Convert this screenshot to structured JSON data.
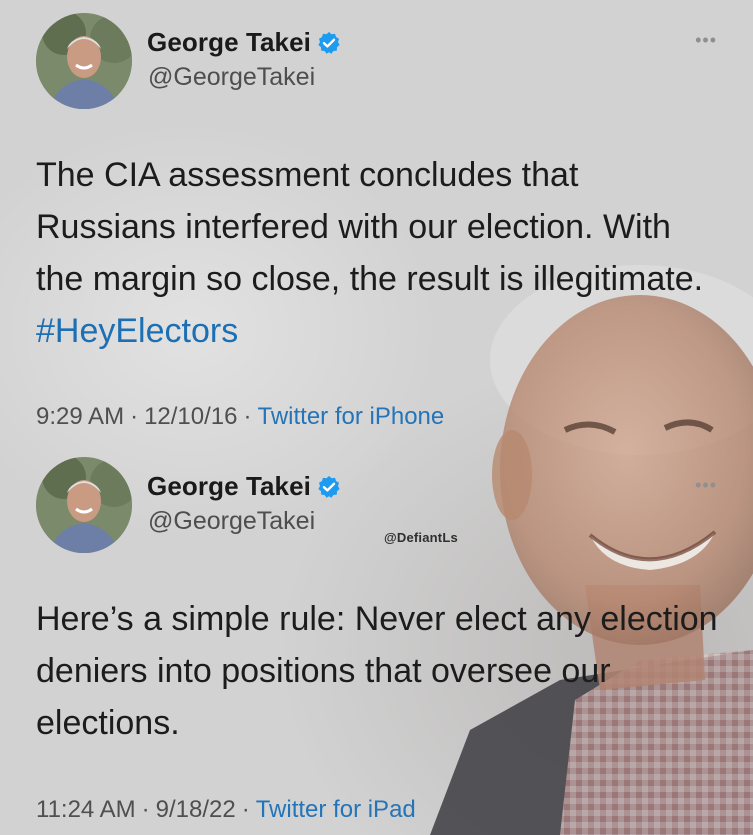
{
  "tweets": [
    {
      "author": {
        "name": "George Takei",
        "handle": "@GeorgeTakei",
        "verified": true
      },
      "text_parts": {
        "main": "The CIA assessment concludes that Russians interfered with our election. With the margin so close, the result is illegitimate.",
        "hashtag": "#HeyElectors"
      },
      "time": "9:29 AM",
      "date": "12/10/16",
      "source": "Twitter for iPhone",
      "more_icon": "•••"
    },
    {
      "author": {
        "name": "George Takei",
        "handle": "@GeorgeTakei",
        "verified": true
      },
      "text_parts": {
        "main": "Here’s a simple rule: Never elect any election deniers into positions that oversee our elections."
      },
      "time": "11:24 AM",
      "date": "9/18/22",
      "source": "Twitter for iPad",
      "more_icon": "•••"
    }
  ],
  "watermark": "@DefiantLs",
  "separator": "·",
  "colors": {
    "link": "#1d6fb4",
    "verified": "#1d9bf0",
    "background": "#d2d2d2"
  },
  "icons": {
    "verified": "verified-badge-icon",
    "more": "more-options-icon"
  }
}
